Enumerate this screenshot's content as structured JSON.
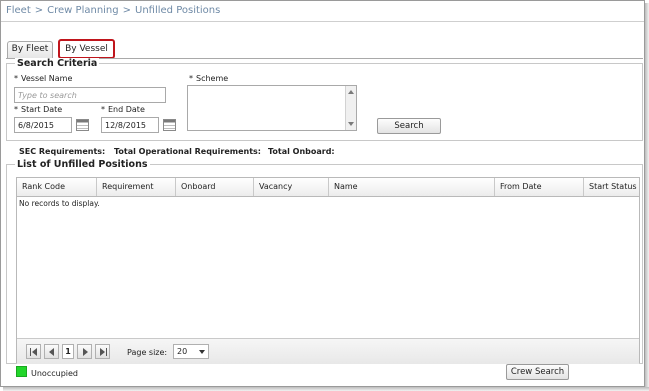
{
  "breadcrumb": {
    "items": [
      "Fleet",
      "Crew Planning",
      "Unfilled Positions"
    ],
    "separator": ">"
  },
  "tabs": [
    {
      "label": "By Fleet",
      "selected": false
    },
    {
      "label": "By Vessel",
      "selected": true
    }
  ],
  "search": {
    "title": "Search Criteria",
    "required_mark": "*",
    "vessel_label": "Vessel Name",
    "vessel_placeholder": "Type to search",
    "vessel_value": "",
    "scheme_label": "Scheme",
    "start_label": "Start Date",
    "start_value": "6/8/2015",
    "end_label": "End Date",
    "end_value": "12/8/2015",
    "search_button": "Search"
  },
  "totals": {
    "sec": "SEC Requirements:",
    "operational": "Total Operational Requirements:",
    "onboard": "Total Onboard:"
  },
  "list": {
    "title": "List of Unfilled Positions",
    "columns": [
      "Rank Code",
      "Requirement",
      "Onboard",
      "Vacancy",
      "Name",
      "From Date",
      "Start Status"
    ],
    "empty_text": "No records to display.",
    "pager": {
      "current_page": "1",
      "page_size_label": "Page size:",
      "page_size": "20"
    }
  },
  "legend": {
    "label": "Unoccupied",
    "color": "#22d62a"
  },
  "crew_search_button": "Crew Search",
  "colors": {
    "breadcrumb": "#6f8aa6",
    "tab_highlight": "#c0151c"
  }
}
